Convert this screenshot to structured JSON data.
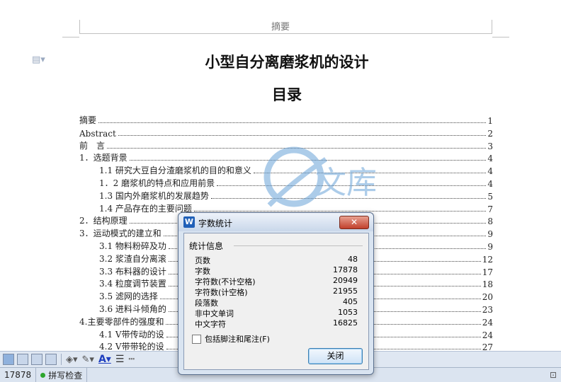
{
  "header": {
    "text": "摘要"
  },
  "document": {
    "title": "小型自分离磨浆机的设计",
    "subtitle": "目录",
    "toc": [
      {
        "text": "摘要",
        "page": "1",
        "indent": 0
      },
      {
        "text": "Abstract",
        "page": "2",
        "indent": 0
      },
      {
        "text": "前　言",
        "page": "3",
        "indent": 0
      },
      {
        "text": "1．选题背景",
        "page": "4",
        "indent": 0
      },
      {
        "text": "1.1 研究大豆自分渣磨浆机的目的和意义",
        "page": "4",
        "indent": 1
      },
      {
        "text": "1．2 磨浆机的特点和应用前景",
        "page": "4",
        "indent": 1
      },
      {
        "text": "1.3 国内外磨浆机的发展趋势",
        "page": "5",
        "indent": 1
      },
      {
        "text": "1.4 产品存在的主要问题",
        "page": "7",
        "indent": 1
      },
      {
        "text": "2．结构原理",
        "page": "8",
        "indent": 0
      },
      {
        "text": "3．运动模式的建立和",
        "page": "9",
        "indent": 0
      },
      {
        "text": "3.1 物料粉碎及功",
        "page": "9",
        "indent": 1
      },
      {
        "text": "3.2 浆渣自分离滚",
        "page": "12",
        "indent": 1
      },
      {
        "text": "3.3 布料器的设计",
        "page": "17",
        "indent": 1
      },
      {
        "text": "3.4 粒度调节装置",
        "page": "18",
        "indent": 1
      },
      {
        "text": "3.5 滤网的选择",
        "page": "20",
        "indent": 1
      },
      {
        "text": "3.6 进料斗倾角的",
        "page": "23",
        "indent": 1
      },
      {
        "text": "4.主要零部件的强度和",
        "page": "24",
        "indent": 0
      },
      {
        "text": "4.1 V带传动的设",
        "page": "24",
        "indent": 1
      },
      {
        "text": "4.2 V带带轮的设",
        "page": "27",
        "indent": 1
      }
    ]
  },
  "watermark": {
    "text": "文库",
    "url": "renrendoc"
  },
  "statusbar": {
    "count": "17878",
    "spell": "拼写检查"
  },
  "dialog": {
    "title": "字数统计",
    "icon": "W",
    "close_glyph": "✕",
    "group": "统计信息",
    "stats": [
      {
        "label": "页数",
        "value": "48"
      },
      {
        "label": "字数",
        "value": "17878"
      },
      {
        "label": "字符数(不计空格)",
        "value": "20949"
      },
      {
        "label": "字符数(计空格)",
        "value": "21955"
      },
      {
        "label": "段落数",
        "value": "405"
      },
      {
        "label": "非中文单词",
        "value": "1053"
      },
      {
        "label": "中文字符",
        "value": "16825"
      }
    ],
    "checkbox_label": "包括脚注和尾注(F)",
    "checkbox_checked": false,
    "button_label": "关闭"
  },
  "colors": {
    "accent": "#2060b8",
    "close_red": "#c1402c",
    "watermark_blue": "#6aa3d8"
  }
}
